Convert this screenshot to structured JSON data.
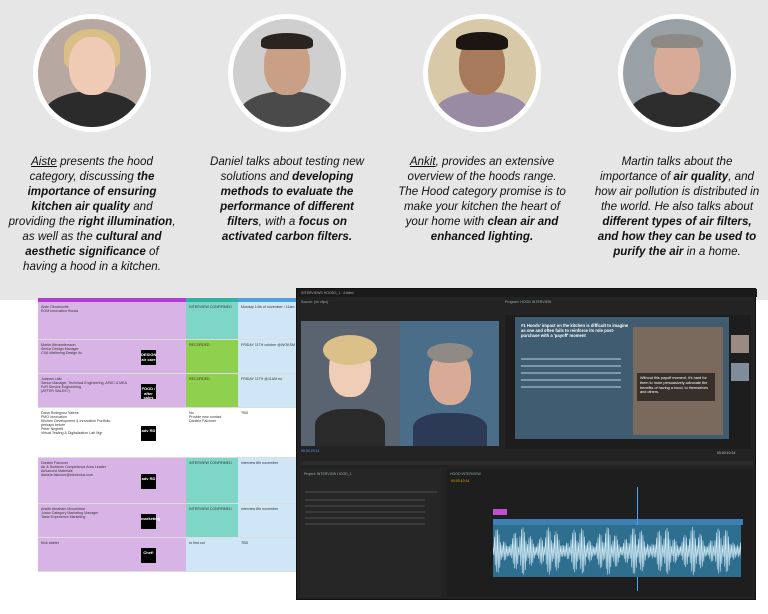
{
  "people": [
    {
      "name": "Aiste",
      "text_parts": [
        {
          "t": "Aiste",
          "s": "u"
        },
        {
          "t": " presents the hood category, discussing ",
          "s": ""
        },
        {
          "t": "the importance of ensuring kitchen air quality",
          "s": "b"
        },
        {
          "t": " and providing the ",
          "s": ""
        },
        {
          "t": "right illumination",
          "s": "b"
        },
        {
          "t": ", as well as the ",
          "s": ""
        },
        {
          "t": "cultural and aesthetic significance",
          "s": "b"
        },
        {
          "t": " of having a hood in a kitchen.",
          "s": ""
        }
      ]
    },
    {
      "name": "Daniel",
      "text_parts": [
        {
          "t": "Daniel talks about testing new solutions and ",
          "s": ""
        },
        {
          "t": "developing methods to evaluate the performance of different filters",
          "s": "b"
        },
        {
          "t": ", with a ",
          "s": ""
        },
        {
          "t": "focus on activated carbon filters.",
          "s": "b"
        }
      ]
    },
    {
      "name": "Ankit",
      "text_parts": [
        {
          "t": "Ankit",
          "s": "u"
        },
        {
          "t": ", provides an extensive overview of the hoods range. The Hood category promise is to make your kitchen the heart of your home with ",
          "s": ""
        },
        {
          "t": "clean air and enhanced lighting.",
          "s": "b"
        }
      ]
    },
    {
      "name": "Martin",
      "text_parts": [
        {
          "t": "Martin talks about the importance of ",
          "s": ""
        },
        {
          "t": "air quality",
          "s": "b"
        },
        {
          "t": ", and how air pollution is distributed in the world. He also talks about ",
          "s": ""
        },
        {
          "t": "different types of air filters, and how they can be used to purify the air",
          "s": "b"
        },
        {
          "t": " in a home.",
          "s": ""
        }
      ]
    }
  ],
  "sheet": {
    "rows": [
      {
        "c1": "Aiste Obrotnovite\nEOM Innovation Hoods",
        "logo": "",
        "c2": "INTERVIEW CONFIRMED",
        "c3": "Monday 14th of november / 11am",
        "c1bg": "#d8b3e6",
        "c2bg": "#7ed6c7",
        "c3bg": "#cfe6f7"
      },
      {
        "c1": "Martin Alexandersson\nSenior Design Manager\nCXA Wellbeing Design Itc",
        "logo": "DESIGN\nair care",
        "c2": "RECORDED",
        "c3": "FRIDAY 11TH october @WOKSM",
        "c1bg": "#d8b3e6",
        "c2bg": "#8fd14f",
        "c3bg": "#cfe6f7"
      },
      {
        "c1": "Jolanan Lalic\nSenior Manager, Technical Engineering, APAC & MEA\nFoR Service Engineering\n(AFTER SALES?)",
        "logo": "FOOD / after sales",
        "c2": "RECORDED",
        "c3": "FRIDAY 11TH @11AM eu",
        "c1bg": "#d8b3e6",
        "c2bg": "#8fd14f",
        "c3bg": "#cfe6f7"
      },
      {
        "c1": "Dana Rodriguez Valens\nPMO Innovation\nKitchen Development & Innovation Portfolio\nperhaps before\nPeter Negretti\nVirtual Testing & Digitalization Lab Mgr",
        "logo": "adv RD",
        "c2": "No\nProvide new contact\nDaniele Falconer",
        "c3": "TBD",
        "c1bg": "#ffffff",
        "c2bg": "#ffffff",
        "c3bg": "#ffffff"
      },
      {
        "c1": "Daniele Falconer\nAir & Surfaces Competence Area Leader\nAdvanced Materials\ndaniele.falconer@electrolux.com",
        "logo": "adv RD",
        "c2": "INTERVIEW CONFIRMED",
        "c3": "interview 8th november",
        "c1bg": "#d8b3e6",
        "c2bg": "#7ed6c7",
        "c3bg": "#cfe6f7"
      },
      {
        "c1": "Ankith Abraham Moozhithal\nJunior Category Marketing Manager\nTaste Experience Marketing",
        "logo": "marketing",
        "c2": "INTERVIEW CONFIRMED",
        "c3": "interview 8th november",
        "c1bg": "#d8b3e6",
        "c2bg": "#7ed6c7",
        "c3bg": "#cfe6f7"
      },
      {
        "c1": "Kick starter",
        "logo": "Chef!",
        "c2": "to find out",
        "c3": "TBD",
        "c1bg": "#d8b3e6",
        "c2bg": "#cfe6f7",
        "c3bg": "#cfe6f7"
      }
    ]
  },
  "premiere": {
    "title": "INTERVIEWS HOODS_1 - Edited",
    "source_tab": "Source: (no clips)",
    "program_tab": "Program: HOOD INTERVIEW",
    "slide_title": "#1 Hoods' impact on the kitchen is difficult to imagine as one and often fails to reinforce its role post-purchase with a 'payoff' moment",
    "slide_quote": "Without this payoff moment, it's hard for them to more persuasively advocate the benefits of having a hood, to themselves and others.",
    "timecode_left": "00:00:23:14",
    "timecode_right": "00:00:10:14",
    "project_tab": "Project: INTERVIEW HOOD_1",
    "timeline_tab": "HOOD INTERVIEW",
    "timeline_timecode": "00:00:10:14"
  },
  "colors": {
    "top_bg": "#e6e6e6",
    "pr_bg": "#232323",
    "wave": "#2e86ab"
  }
}
